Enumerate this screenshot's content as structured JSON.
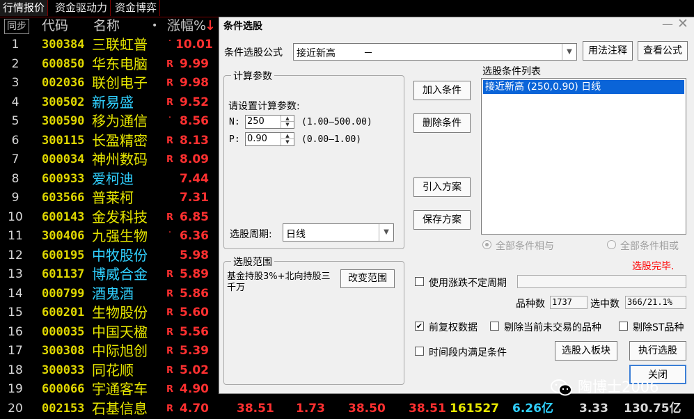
{
  "tabs": [
    "行情报价",
    "资金驱动力",
    "资金博弈"
  ],
  "table": {
    "sync_label": "同步",
    "headers": {
      "code": "代码",
      "name": "名称",
      "dot": "•",
      "pct": "涨幅%",
      "sort_arrow": "↓"
    },
    "rows": [
      {
        "no": "1",
        "code": "300384",
        "name": "三联虹普",
        "flag": "˙",
        "pct": "10.01",
        "cyan": false
      },
      {
        "no": "2",
        "code": "600850",
        "name": "华东电脑",
        "flag": "R",
        "pct": "9.99",
        "cyan": false
      },
      {
        "no": "3",
        "code": "002036",
        "name": "联创电子",
        "flag": "R",
        "pct": "9.98",
        "cyan": false
      },
      {
        "no": "4",
        "code": "300502",
        "name": "新易盛",
        "flag": "R",
        "pct": "9.52",
        "cyan": true
      },
      {
        "no": "5",
        "code": "300590",
        "name": "移为通信",
        "flag": "˙",
        "pct": "8.56",
        "cyan": false
      },
      {
        "no": "6",
        "code": "300115",
        "name": "长盈精密",
        "flag": "R",
        "pct": "8.13",
        "cyan": false
      },
      {
        "no": "7",
        "code": "000034",
        "name": "神州数码",
        "flag": "R",
        "pct": "8.09",
        "cyan": false
      },
      {
        "no": "8",
        "code": "600933",
        "name": "爱柯迪",
        "flag": "",
        "pct": "7.44",
        "cyan": true
      },
      {
        "no": "9",
        "code": "603566",
        "name": "普莱柯",
        "flag": "",
        "pct": "7.31",
        "cyan": false
      },
      {
        "no": "10",
        "code": "600143",
        "name": "金发科技",
        "flag": "R",
        "pct": "6.85",
        "cyan": false
      },
      {
        "no": "11",
        "code": "300406",
        "name": "九强生物",
        "flag": "˙",
        "pct": "6.36",
        "cyan": false
      },
      {
        "no": "12",
        "code": "600195",
        "name": "中牧股份",
        "flag": "",
        "pct": "5.98",
        "cyan": true
      },
      {
        "no": "13",
        "code": "601137",
        "name": "博威合金",
        "flag": "R",
        "pct": "5.89",
        "cyan": true
      },
      {
        "no": "14",
        "code": "000799",
        "name": "酒鬼酒",
        "flag": "R",
        "pct": "5.86",
        "cyan": true
      },
      {
        "no": "15",
        "code": "600201",
        "name": "生物股份",
        "flag": "R",
        "pct": "5.60",
        "cyan": false
      },
      {
        "no": "16",
        "code": "000035",
        "name": "中国天楹",
        "flag": "R",
        "pct": "5.56",
        "cyan": false
      },
      {
        "no": "17",
        "code": "300308",
        "name": "中际旭创",
        "flag": "R",
        "pct": "5.39",
        "cyan": false
      },
      {
        "no": "18",
        "code": "300033",
        "name": "同花顺",
        "flag": "R",
        "pct": "5.02",
        "cyan": false
      },
      {
        "no": "19",
        "code": "600066",
        "name": "宇通客车",
        "flag": "R",
        "pct": "4.90",
        "cyan": false
      },
      {
        "no": "20",
        "code": "002153",
        "name": "石基信息",
        "flag": "R",
        "pct": "4.70",
        "cyan": false
      }
    ],
    "row20_extra": [
      "38.51",
      "1.73",
      "38.50",
      "38.51",
      "161527",
      "6.26亿",
      "3.33",
      "130.75亿"
    ],
    "colors": {
      "red": "#ff3030",
      "yellow": "#e6e600",
      "cyan": "#30d0ff",
      "white": "#d8d8d8"
    }
  },
  "dialog": {
    "title": "条件选股",
    "minimize": "—",
    "close": "✕",
    "formula_label": "条件选股公式",
    "formula_value": "接近新高",
    "formula_dash": "－",
    "usage_btn": "用法注释",
    "view_formula_btn": "查看公式",
    "calc_group": "计算参数",
    "set_params": "请设置计算参数:",
    "n_label": "N:",
    "n_value": "250",
    "n_range": "(1.00—500.00)",
    "p_label": "P:",
    "p_value": "0.90",
    "p_range": "(0.00—1.00)",
    "period_label": "选股周期:",
    "period_value": "日线",
    "add_cond": "加入条件",
    "del_cond": "删除条件",
    "import_plan": "引入方案",
    "save_plan": "保存方案",
    "list_title": "选股条件列表",
    "list_item": "接近新高 (250,0.90) 日线",
    "radio_and": "全部条件相与",
    "radio_or": "全部条件相或",
    "status": "选股完毕.",
    "scope_group": "选股范围",
    "scope_value": "基金持股3%+北向持股三千万",
    "change_scope": "改变范围",
    "uncertain_period": "使用涨跌不定周期",
    "count_label": "品种数",
    "count_value": "1737",
    "selected_label": "选中数",
    "selected_value": "366/21.1%",
    "pre_adjust": "前复权数据",
    "remove_untraded": "剔除当前未交易的品种",
    "remove_st": "剔除ST品种",
    "time_range": "时间段内满足条件",
    "to_block": "选股入板块",
    "execute": "执行选股",
    "close_btn": "关闭"
  },
  "watermark": "陶博士2006"
}
